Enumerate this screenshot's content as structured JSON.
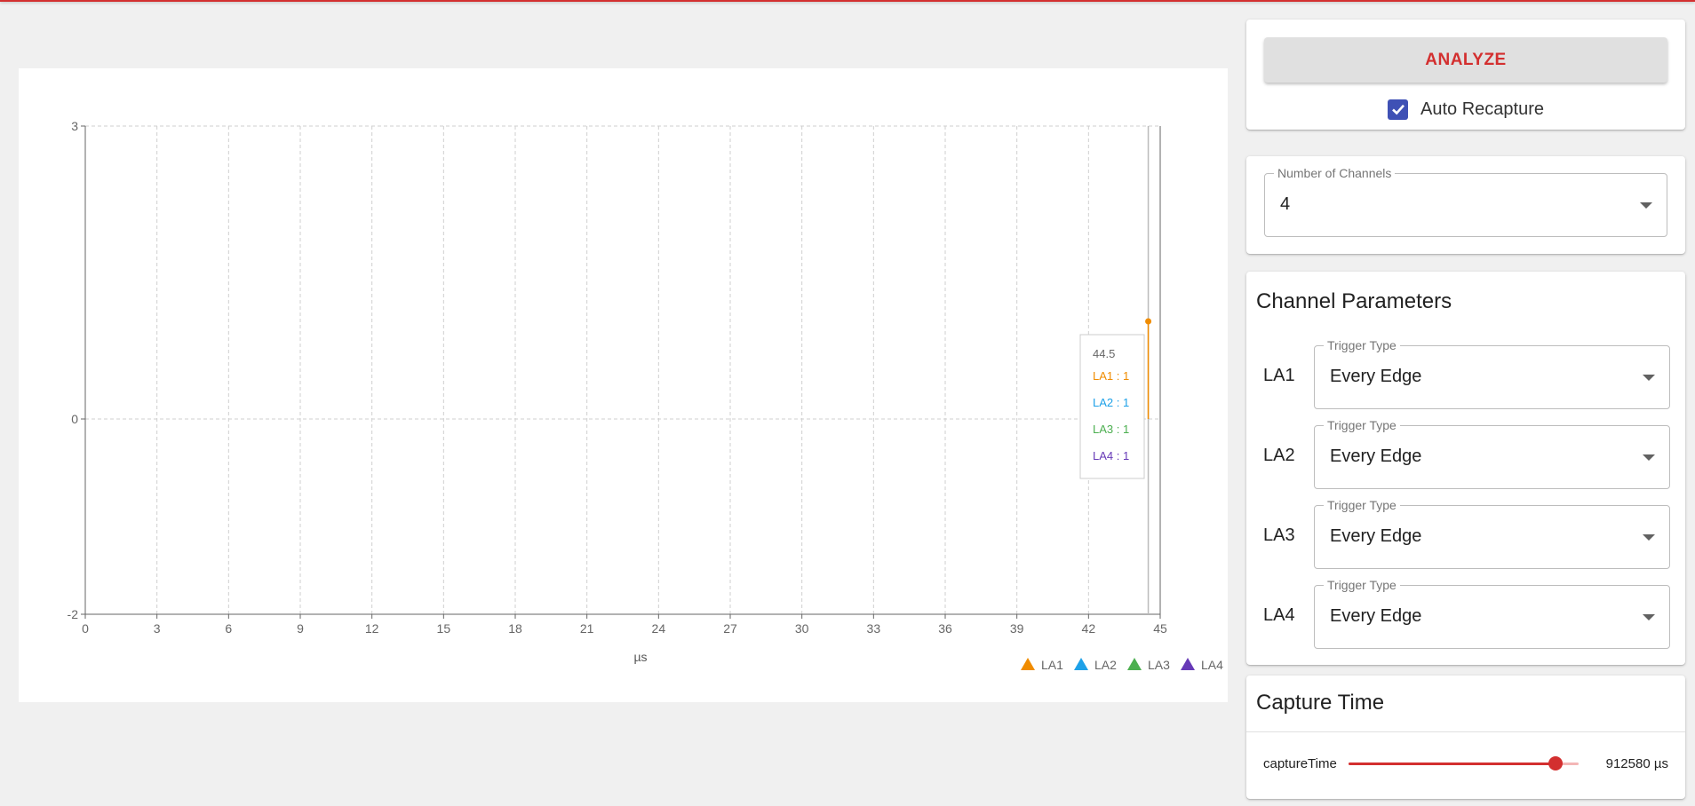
{
  "controls": {
    "analyze_label": "ANALYZE",
    "auto_recapture_label": "Auto Recapture",
    "auto_recapture_checked": true
  },
  "channels_select": {
    "label": "Number of Channels",
    "value": "4"
  },
  "channel_params": {
    "title": "Channel Parameters",
    "trigger_label": "Trigger Type",
    "channels": [
      {
        "name": "LA1",
        "trigger": "Every Edge"
      },
      {
        "name": "LA2",
        "trigger": "Every Edge"
      },
      {
        "name": "LA3",
        "trigger": "Every Edge"
      },
      {
        "name": "LA4",
        "trigger": "Every Edge"
      }
    ]
  },
  "capture_time": {
    "title": "Capture Time",
    "slider_label": "captureTime",
    "value_text": "912580 µs",
    "slider_fraction": 0.9
  },
  "chart_data": {
    "type": "line",
    "xlabel": "µs",
    "xlim": [
      0,
      45
    ],
    "ylim": [
      -2,
      3
    ],
    "x_ticks": [
      0,
      3,
      6,
      9,
      12,
      15,
      18,
      21,
      24,
      27,
      30,
      33,
      36,
      39,
      42,
      45
    ],
    "y_ticks": [
      -2,
      0,
      3
    ],
    "grid": true,
    "legend_position": "bottom-right",
    "series": [
      {
        "name": "LA1",
        "color": "#f08c00",
        "points": [
          [
            44.5,
            1
          ]
        ]
      },
      {
        "name": "LA2",
        "color": "#1ea1e8",
        "points": [
          [
            44.5,
            1
          ]
        ]
      },
      {
        "name": "LA3",
        "color": "#4caf50",
        "points": [
          [
            44.5,
            1
          ]
        ]
      },
      {
        "name": "LA4",
        "color": "#673ab7",
        "points": [
          [
            44.5,
            1
          ]
        ]
      }
    ],
    "tooltip": {
      "x": "44.5",
      "rows": [
        "LA1 : 1",
        "LA2 : 1",
        "LA3 : 1",
        "LA4 : 1"
      ]
    }
  }
}
